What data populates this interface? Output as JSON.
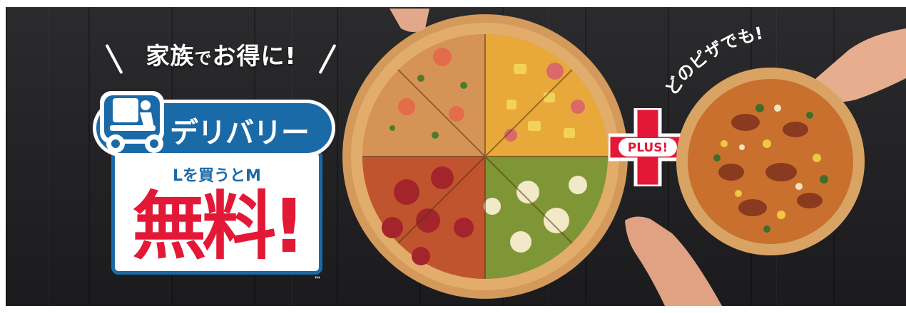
{
  "banner": {
    "tagline": {
      "part1": "家族",
      "part2": "で",
      "part3": "お得に!"
    },
    "logo": {
      "service_label": "デリバリー",
      "offer_line": "Lを買うとM",
      "free_label": "無料!",
      "trademark": "™"
    },
    "plus_badge": "PLUS!",
    "any_pizza_text": "どのピザでも!",
    "colors": {
      "brand_blue": "#1b6aa8",
      "brand_red": "#e31837",
      "background": "#252527"
    }
  }
}
